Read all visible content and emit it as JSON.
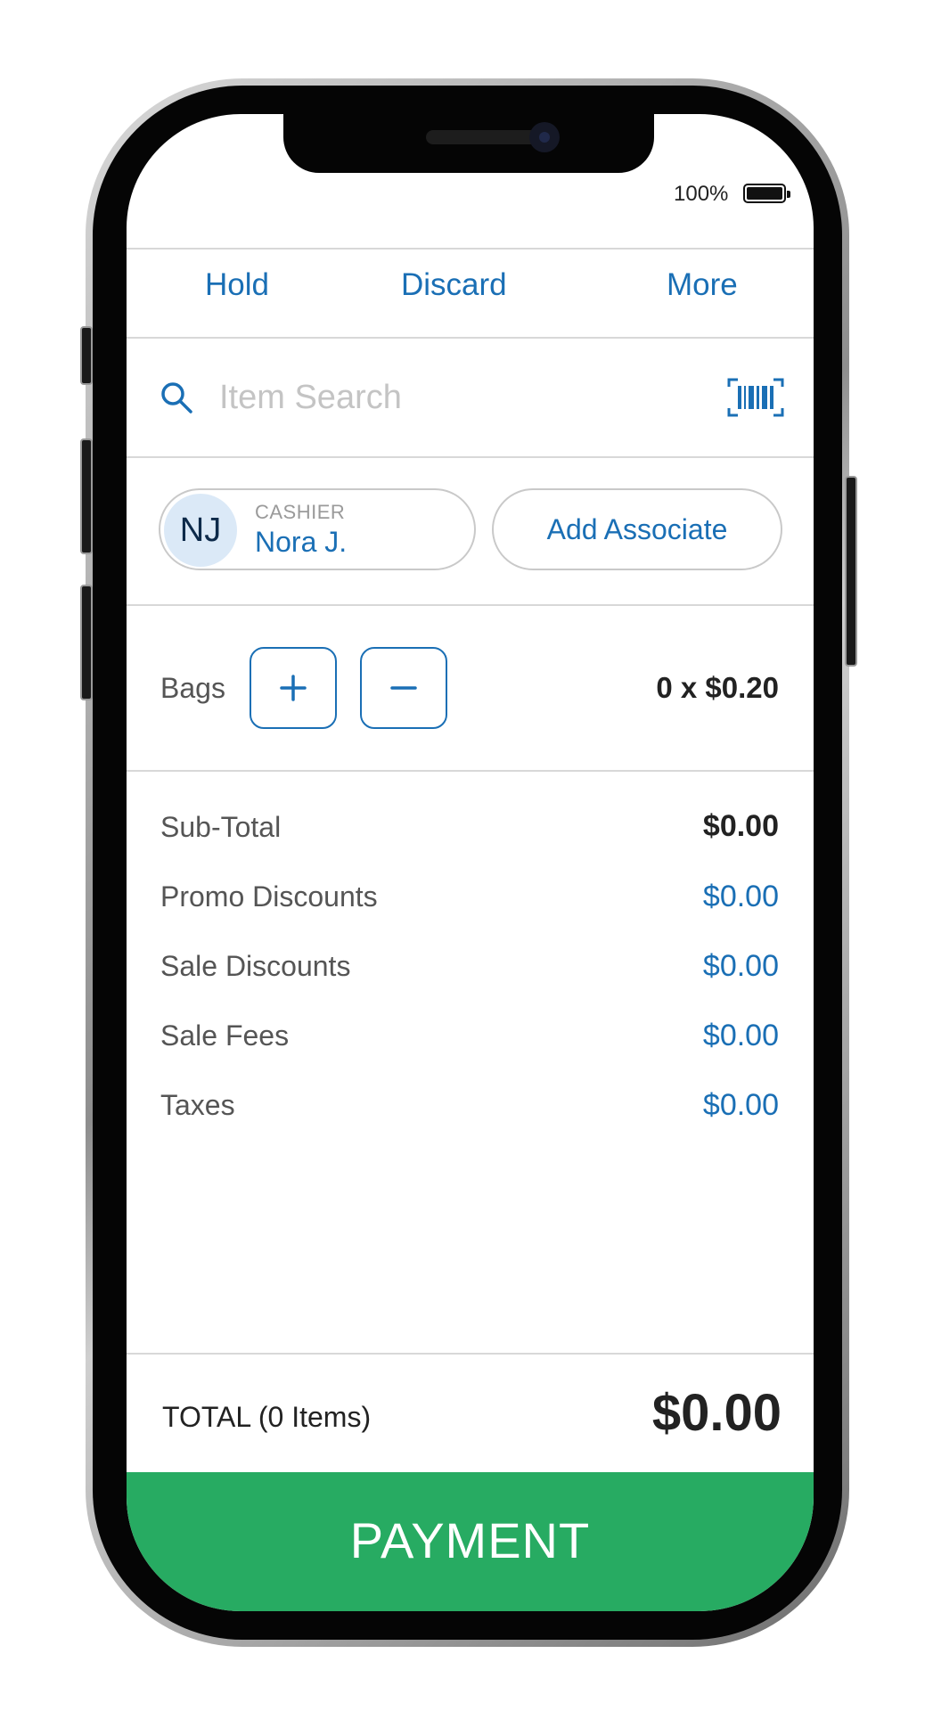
{
  "status_bar": {
    "battery_percent": "100%",
    "battery_level": 1.0
  },
  "toolbar": {
    "hold": "Hold",
    "discard": "Discard",
    "more": "More"
  },
  "search": {
    "placeholder": "Item Search",
    "value": "",
    "icon": "search-icon",
    "scan_icon": "barcode-icon"
  },
  "cashier": {
    "initials": "NJ",
    "role": "CASHIER",
    "name": "Nora J."
  },
  "associate": {
    "button_label": "Add Associate"
  },
  "bags": {
    "label": "Bags",
    "plus_icon": "plus-icon",
    "minus_icon": "minus-icon",
    "quantity_price": "0 x $0.20"
  },
  "summary": {
    "rows": [
      {
        "label": "Sub-Total",
        "value": "$0.00"
      },
      {
        "label": "Promo Discounts",
        "value": "$0.00"
      },
      {
        "label": "Sale Discounts",
        "value": "$0.00"
      },
      {
        "label": "Sale Fees",
        "value": "$0.00"
      },
      {
        "label": "Taxes",
        "value": "$0.00"
      }
    ]
  },
  "total": {
    "label": "TOTAL (0 Items)",
    "value": "$0.00"
  },
  "payment": {
    "label": "PAYMENT"
  },
  "colors": {
    "accent": "#1a6fb5",
    "payment_green": "#27ab62",
    "avatar_bg": "#dbe9f7"
  }
}
